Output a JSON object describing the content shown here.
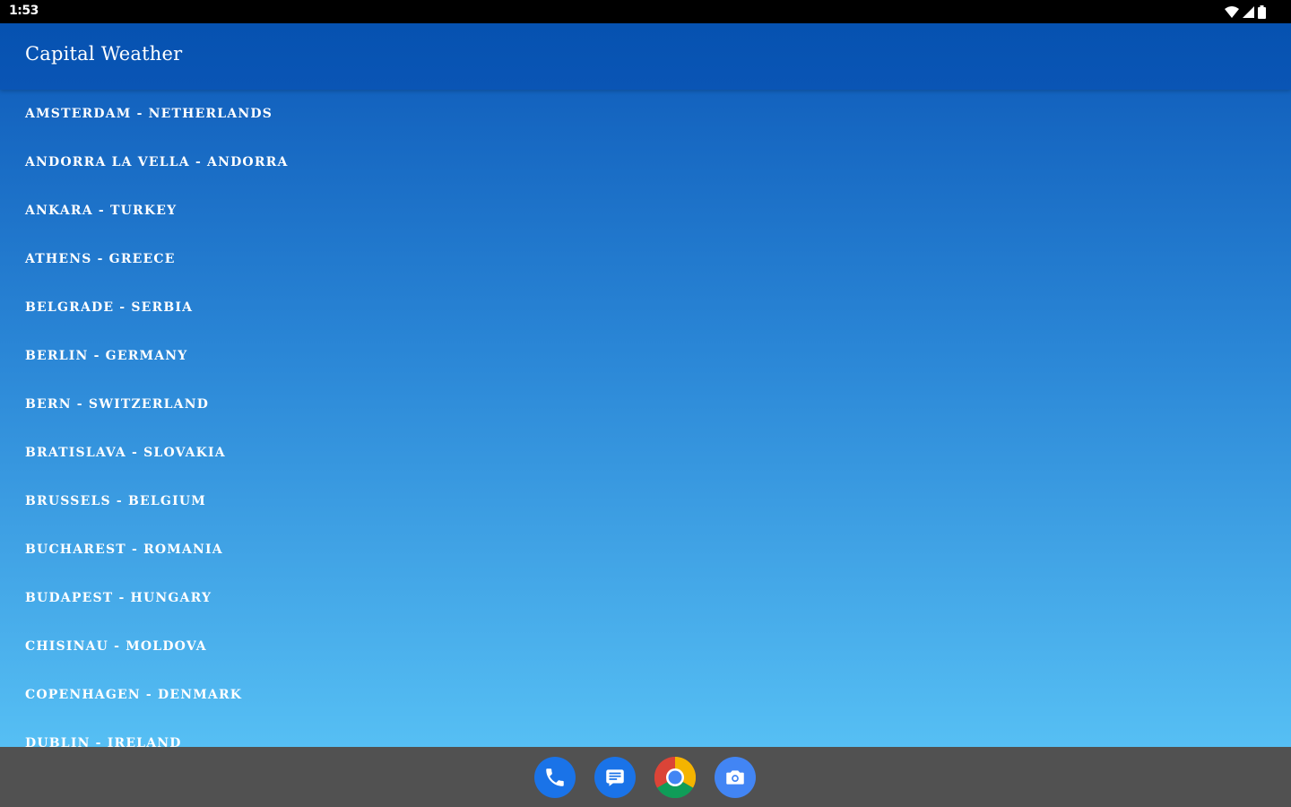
{
  "status_bar": {
    "time": "1:53",
    "icons": [
      "wifi-icon",
      "cell-signal-icon",
      "battery-icon"
    ]
  },
  "app": {
    "title": "Capital Weather",
    "colors": {
      "app_bar": "#0652b0",
      "gradient_top": "#0d59b8",
      "gradient_bottom": "#56bff4",
      "text": "#ffffff"
    }
  },
  "cities": [
    {
      "label": "AMSTERDAM - NETHERLANDS"
    },
    {
      "label": "ANDORRA LA VELLA - ANDORRA"
    },
    {
      "label": "ANKARA - TURKEY"
    },
    {
      "label": "ATHENS - GREECE"
    },
    {
      "label": "BELGRADE - SERBIA"
    },
    {
      "label": "BERLIN - GERMANY"
    },
    {
      "label": "BERN - SWITZERLAND"
    },
    {
      "label": "BRATISLAVA - SLOVAKIA"
    },
    {
      "label": "BRUSSELS - BELGIUM"
    },
    {
      "label": "BUCHAREST - ROMANIA"
    },
    {
      "label": "BUDAPEST - HUNGARY"
    },
    {
      "label": "CHISINAU - MOLDOVA"
    },
    {
      "label": "COPENHAGEN - DENMARK"
    },
    {
      "label": "DUBLIN - IRELAND"
    }
  ],
  "dock": {
    "apps": [
      "phone-icon",
      "messages-icon",
      "chrome-icon",
      "camera-icon"
    ],
    "colors": {
      "background": "#515151",
      "phone": "#1a73e8",
      "messages": "#1a73e8",
      "camera": "#4285f4"
    }
  }
}
